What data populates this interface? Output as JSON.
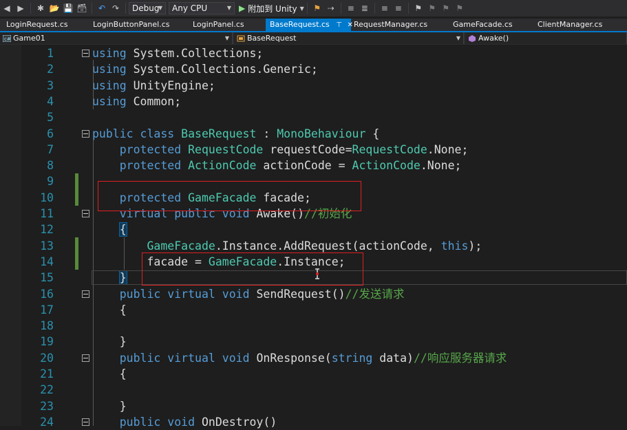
{
  "toolbar": {
    "config": "Debug",
    "platform": "Any CPU",
    "attach_label": "附加到 Unity"
  },
  "tabs": [
    "LoginRequest.cs",
    "LoginButtonPanel.cs",
    "LoginPanel.cs",
    "BaseRequest.cs",
    "RequestManager.cs",
    "GameFacade.cs",
    "ClientManager.cs"
  ],
  "active_tab_index": 3,
  "navbar": {
    "project": "Game01",
    "class": "BaseRequest",
    "member": "Awake()"
  },
  "code_lines": [
    {
      "n": "1",
      "tokens": [
        [
          "kw",
          "using"
        ],
        [
          "tx",
          " System.Collections;"
        ]
      ]
    },
    {
      "n": "2",
      "tokens": [
        [
          "kw",
          "using"
        ],
        [
          "tx",
          " System.Collections.Generic;"
        ]
      ]
    },
    {
      "n": "3",
      "tokens": [
        [
          "kw",
          "using"
        ],
        [
          "tx",
          " UnityEngine;"
        ]
      ]
    },
    {
      "n": "4",
      "tokens": [
        [
          "kw",
          "using"
        ],
        [
          "tx",
          " Common;"
        ]
      ]
    },
    {
      "n": "5",
      "tokens": []
    },
    {
      "n": "6",
      "tokens": [
        [
          "kw",
          "public"
        ],
        [
          "tx",
          " "
        ],
        [
          "kw",
          "class"
        ],
        [
          "tx",
          " "
        ],
        [
          "ty",
          "BaseRequest"
        ],
        [
          "tx",
          " : "
        ],
        [
          "ty",
          "MonoBehaviour"
        ],
        [
          "tx",
          " {"
        ]
      ]
    },
    {
      "n": "7",
      "tokens": [
        [
          "tx",
          "    "
        ],
        [
          "kw",
          "protected"
        ],
        [
          "tx",
          " "
        ],
        [
          "ty",
          "RequestCode"
        ],
        [
          "tx",
          " requestCode="
        ],
        [
          "ty",
          "RequestCode"
        ],
        [
          "tx",
          ".None;"
        ]
      ]
    },
    {
      "n": "8",
      "tokens": [
        [
          "tx",
          "    "
        ],
        [
          "kw",
          "protected"
        ],
        [
          "tx",
          " "
        ],
        [
          "ty",
          "ActionCode"
        ],
        [
          "tx",
          " actionCode = "
        ],
        [
          "ty",
          "ActionCode"
        ],
        [
          "tx",
          ".None;"
        ]
      ]
    },
    {
      "n": "9",
      "tokens": []
    },
    {
      "n": "10",
      "tokens": [
        [
          "tx",
          "    "
        ],
        [
          "kw",
          "protected"
        ],
        [
          "tx",
          " "
        ],
        [
          "ty",
          "GameFacade"
        ],
        [
          "tx",
          " facade;"
        ]
      ]
    },
    {
      "n": "11",
      "tokens": [
        [
          "tx",
          "    "
        ],
        [
          "kw",
          "virtual"
        ],
        [
          "tx",
          " "
        ],
        [
          "kw",
          "public"
        ],
        [
          "tx",
          " "
        ],
        [
          "kw",
          "void"
        ],
        [
          "tx",
          " Awake()"
        ],
        [
          "cm",
          "//初始化"
        ]
      ]
    },
    {
      "n": "12",
      "tokens": [
        [
          "tx",
          "    {"
        ]
      ]
    },
    {
      "n": "13",
      "tokens": [
        [
          "tx",
          "        "
        ],
        [
          "ty",
          "GameFacade"
        ],
        [
          "tx",
          ".Instance.AddRequest(actionCode, "
        ],
        [
          "kw",
          "this"
        ],
        [
          "tx",
          ");"
        ]
      ]
    },
    {
      "n": "14",
      "tokens": [
        [
          "tx",
          "        facade = "
        ],
        [
          "ty",
          "GameFacade"
        ],
        [
          "tx",
          ".Instance;"
        ]
      ]
    },
    {
      "n": "15",
      "tokens": [
        [
          "tx",
          "    }"
        ]
      ]
    },
    {
      "n": "16",
      "tokens": [
        [
          "tx",
          "    "
        ],
        [
          "kw",
          "public"
        ],
        [
          "tx",
          " "
        ],
        [
          "kw",
          "virtual"
        ],
        [
          "tx",
          " "
        ],
        [
          "kw",
          "void"
        ],
        [
          "tx",
          " SendRequest()"
        ],
        [
          "cm",
          "//发送请求"
        ]
      ]
    },
    {
      "n": "17",
      "tokens": [
        [
          "tx",
          "    {"
        ]
      ]
    },
    {
      "n": "18",
      "tokens": []
    },
    {
      "n": "19",
      "tokens": [
        [
          "tx",
          "    }"
        ]
      ]
    },
    {
      "n": "20",
      "tokens": [
        [
          "tx",
          "    "
        ],
        [
          "kw",
          "public"
        ],
        [
          "tx",
          " "
        ],
        [
          "kw",
          "virtual"
        ],
        [
          "tx",
          " "
        ],
        [
          "kw",
          "void"
        ],
        [
          "tx",
          " OnResponse("
        ],
        [
          "kw",
          "string"
        ],
        [
          "tx",
          " data)"
        ],
        [
          "cm",
          "//响应服务器请求"
        ]
      ]
    },
    {
      "n": "21",
      "tokens": [
        [
          "tx",
          "    {"
        ]
      ]
    },
    {
      "n": "22",
      "tokens": []
    },
    {
      "n": "23",
      "tokens": [
        [
          "tx",
          "    }"
        ]
      ]
    },
    {
      "n": "24",
      "tokens": [
        [
          "tx",
          "    "
        ],
        [
          "kw",
          "public"
        ],
        [
          "tx",
          " "
        ],
        [
          "kw",
          "void"
        ],
        [
          "tx",
          " OnDestroy()"
        ]
      ]
    }
  ],
  "colors": {
    "keyword": "#569cd6",
    "type": "#4ec9b0",
    "comment": "#57a64a",
    "line_number": "#2b91af",
    "accent": "#007acc",
    "annotation_box": "#e02020"
  }
}
